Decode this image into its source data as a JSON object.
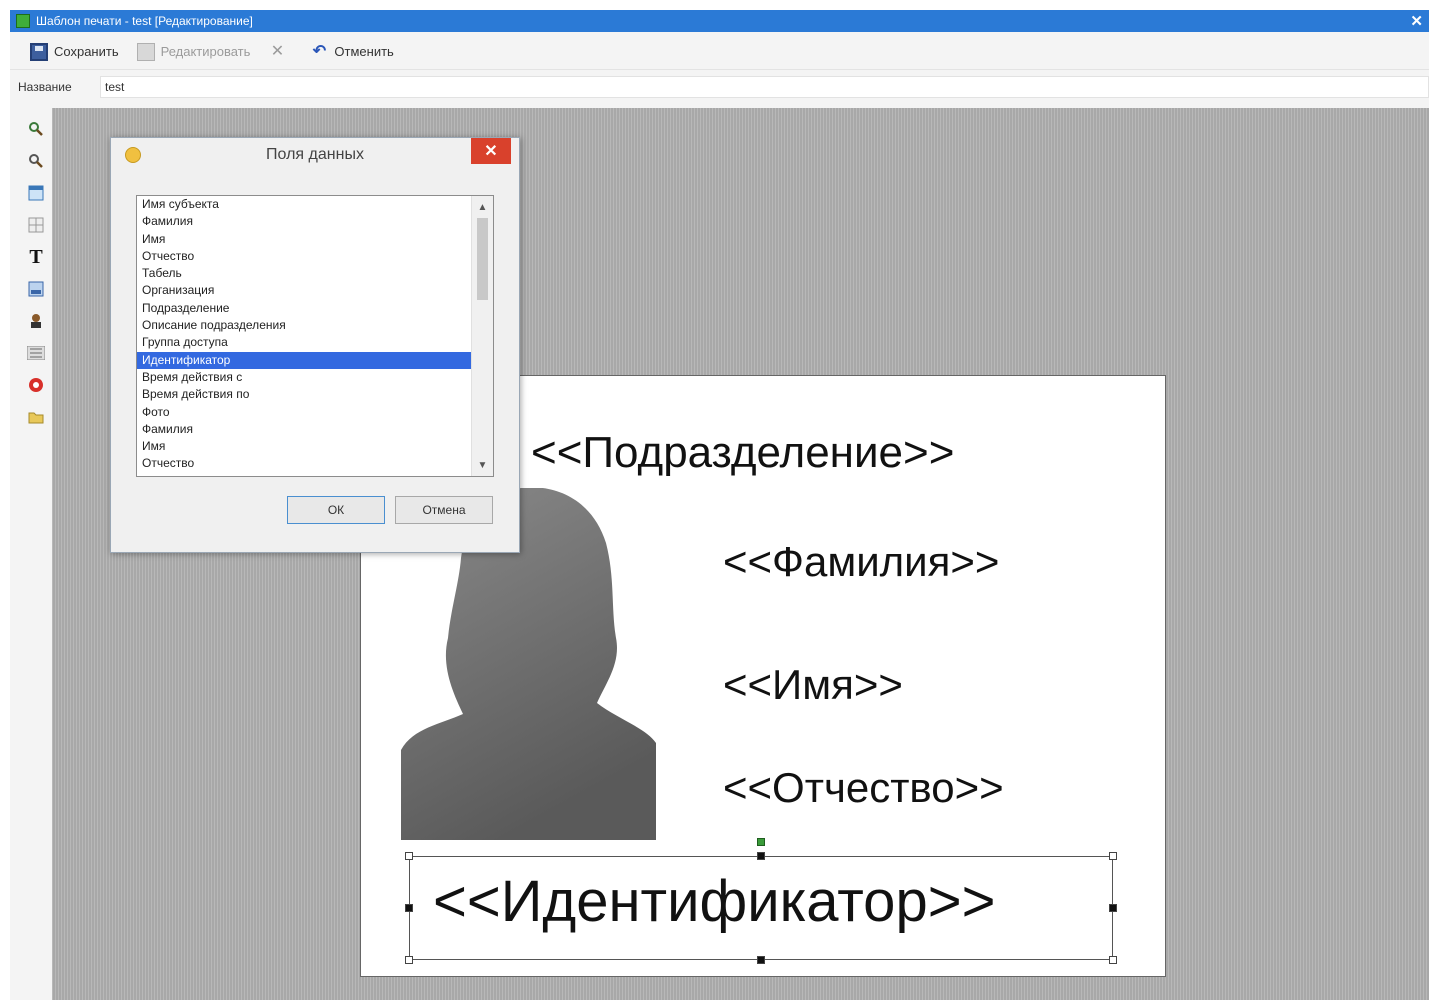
{
  "window": {
    "title": "Шаблон печати - test [Редактирование]"
  },
  "toolbar": {
    "save_label": "Сохранить",
    "edit_label": "Редактировать",
    "undo_label": "Отменить"
  },
  "name_row": {
    "label": "Название",
    "value": "test"
  },
  "palette": {
    "tools": [
      "zoom-in-icon",
      "zoom-out-icon",
      "table-icon",
      "grid-icon",
      "text-tool-icon",
      "image-icon",
      "photo-tool-icon",
      "barcode-icon",
      "record-icon",
      "folder-icon"
    ],
    "text_tool_glyph": "T"
  },
  "dialog": {
    "title": "Поля данных",
    "items": [
      "Имя субъекта",
      "Фамилия",
      "Имя",
      "Отчество",
      "Табель",
      "Организация",
      "Подразделение",
      "Описание подразделения",
      "Группа доступа",
      "Идентификатор",
      "Время действия с",
      "Время действия по",
      "Фото",
      "Фамилия",
      "Имя",
      "Отчество"
    ],
    "selected_index": 9,
    "ok_label": "ОК",
    "cancel_label": "Отмена"
  },
  "card": {
    "podrazdelenie": "<<Подразделение>>",
    "familiya": "<<Фамилия>>",
    "imya": "<<Имя>>",
    "otchestvo": "<<Отчество>>",
    "identifikator": "<<Идентификатор>>"
  },
  "colors": {
    "titlebar": "#2b7ad6",
    "selection": "#3369e0",
    "canvas": "#a8a8a8",
    "close": "#d9412c"
  }
}
